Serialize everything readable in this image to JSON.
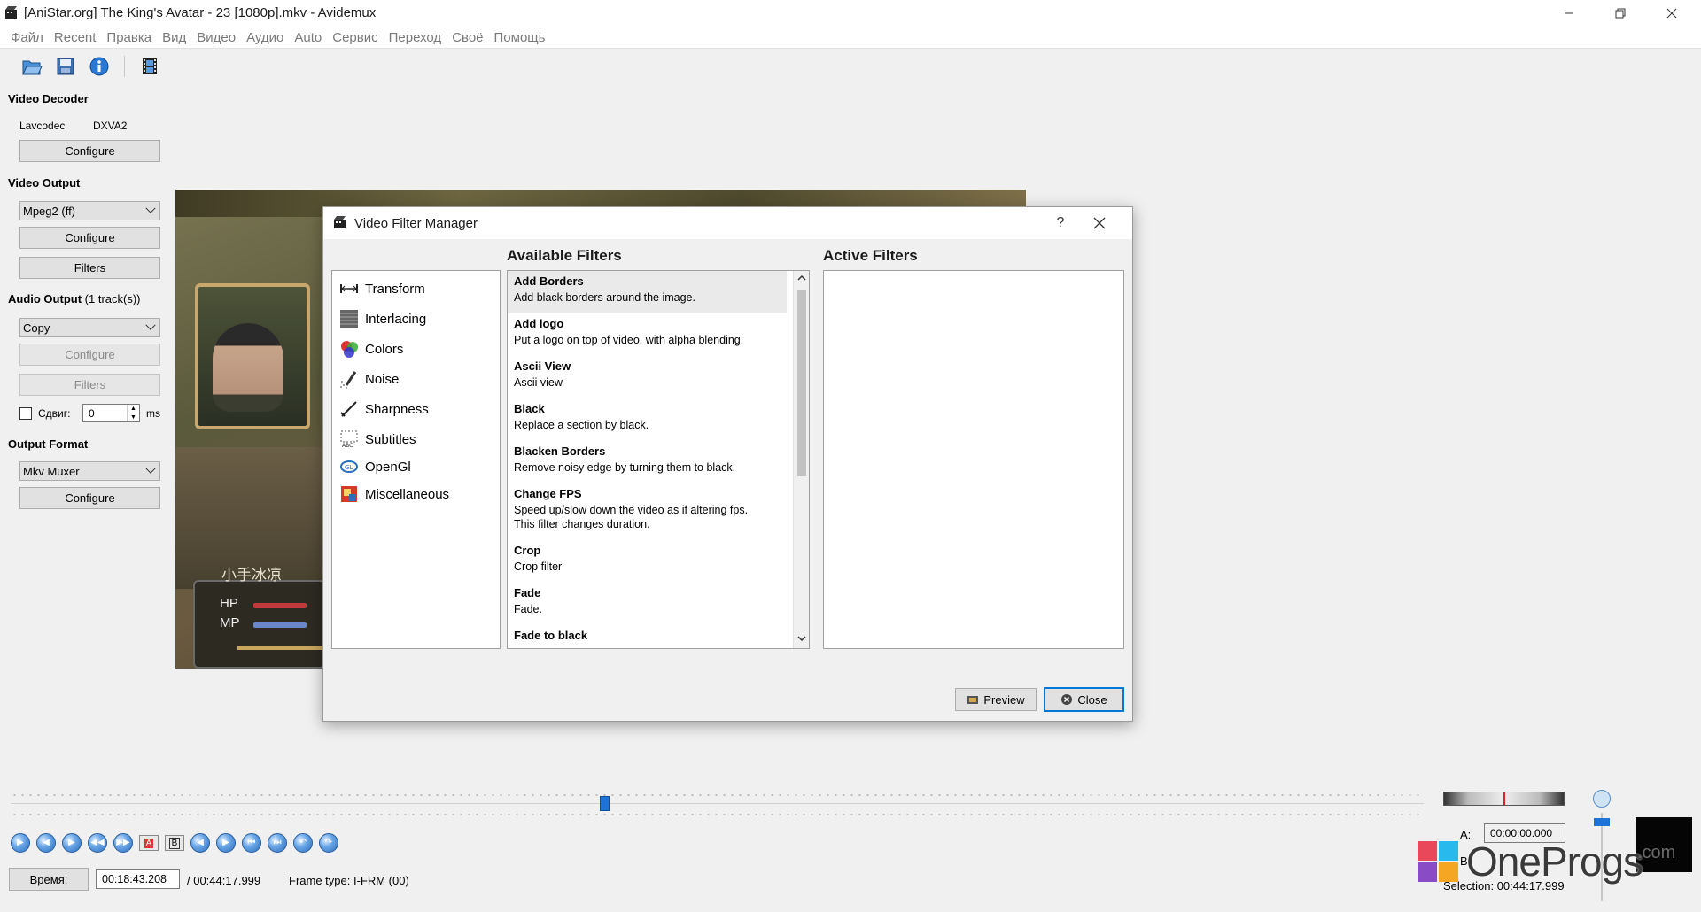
{
  "window": {
    "title": "[AniStar.org] The King's Avatar - 23 [1080p].mkv - Avidemux"
  },
  "menu": [
    "Файл",
    "Recent",
    "Правка",
    "Вид",
    "Видео",
    "Аудио",
    "Auto",
    "Сервис",
    "Переход",
    "Своё",
    "Помощь"
  ],
  "toolbar": {
    "icons": [
      "open-file-icon",
      "save-file-icon",
      "info-icon",
      "film-properties-icon"
    ]
  },
  "left_panel": {
    "video_decoder": {
      "title": "Video Decoder",
      "decoder": "Lavcodec",
      "hw": "DXVA2",
      "configure": "Configure"
    },
    "video_output": {
      "title": "Video Output",
      "codec": "Mpeg2 (ff)",
      "configure": "Configure",
      "filters": "Filters"
    },
    "audio_output": {
      "title": "Audio Output",
      "tracks": "(1 track(s))",
      "codec": "Copy",
      "configure": "Configure",
      "filters": "Filters",
      "shift_label": "Сдвиг:",
      "shift_value": "0",
      "shift_unit": "ms"
    },
    "output_format": {
      "title": "Output Format",
      "muxer": "Mkv Muxer",
      "configure": "Configure"
    }
  },
  "video_overlay": {
    "caption": "小手冰凉",
    "hp": "HP",
    "mp": "MP"
  },
  "dialog": {
    "title": "Video Filter Manager",
    "help": "?",
    "categories": [
      {
        "label": "Transform",
        "icon": "transform-icon"
      },
      {
        "label": "Interlacing",
        "icon": "interlacing-icon"
      },
      {
        "label": "Colors",
        "icon": "colors-icon"
      },
      {
        "label": "Noise",
        "icon": "noise-icon"
      },
      {
        "label": "Sharpness",
        "icon": "sharpness-icon"
      },
      {
        "label": "Subtitles",
        "icon": "subtitles-icon"
      },
      {
        "label": "OpenGl",
        "icon": "opengl-icon"
      },
      {
        "label": "Miscellaneous",
        "icon": "miscellaneous-icon"
      }
    ],
    "available_title": "Available Filters",
    "active_title": "Active Filters",
    "filters": [
      {
        "name": "Add Borders",
        "desc": "Add black borders around the image.",
        "selected": true
      },
      {
        "name": "Add logo",
        "desc": "Put a logo on top of video, with alpha blending."
      },
      {
        "name": "Ascii View",
        "desc": "Ascii view"
      },
      {
        "name": "Black",
        "desc": "Replace a section by black."
      },
      {
        "name": "Blacken Borders",
        "desc": "Remove noisy edge by turning them to black."
      },
      {
        "name": "Change FPS",
        "desc": "Speed up/slow down the video as if altering fps.",
        "desc2": "This filter changes duration."
      },
      {
        "name": "Crop",
        "desc": "Crop filter"
      },
      {
        "name": "Fade",
        "desc": "Fade."
      },
      {
        "name": "Fade to black",
        "desc": ""
      }
    ],
    "preview": "Preview",
    "close": "Close"
  },
  "bottom": {
    "playback_position": 0.42,
    "time_label": "Время:",
    "current_time": "00:18:43.208",
    "total_time": "/ 00:44:17.999",
    "frame_type": "Frame type:  I-FRM (00)",
    "a_label": "A:",
    "a_value": "00:00:00.000",
    "b_label": "B:",
    "selection": "Selection: 00:44:17.999"
  },
  "watermark": {
    "text": "OneProgs",
    "suffix": ".com"
  }
}
